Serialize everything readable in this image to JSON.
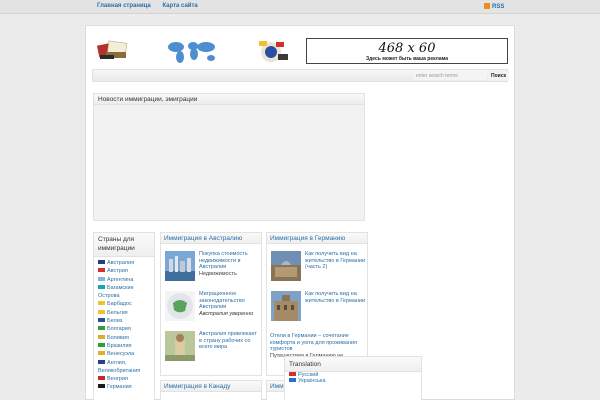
{
  "topnav": {
    "home": "Главная страница",
    "sitemap": "Карта сайта",
    "rss": "RSS"
  },
  "ad": {
    "size": "468 x 60",
    "caption": "Здесь может быть ваша реклама"
  },
  "search": {
    "placeholder": "enter search terms",
    "button": "Поиск"
  },
  "news": {
    "title": "Новости иммиграции, эмиграции"
  },
  "countries": {
    "title": "Страны для иммиграции",
    "items": [
      {
        "label": "Австралия",
        "flag_color": "#1f3d8a"
      },
      {
        "label": "Австрия",
        "flag_color": "#d32f2f"
      },
      {
        "label": "Аргентина",
        "flag_color": "#7fb6e6"
      },
      {
        "label": "Багамские Острова",
        "flag_color": "#1aa3b5"
      },
      {
        "label": "Барбадос",
        "flag_color": "#f2c12e"
      },
      {
        "label": "Бельгия",
        "flag_color": "#f2c12e"
      },
      {
        "label": "Белиз",
        "flag_color": "#2a4ea6"
      },
      {
        "label": "Болгария",
        "flag_color": "#3a9a3a"
      },
      {
        "label": "Боливия",
        "flag_color": "#d8b02a"
      },
      {
        "label": "Бразилия",
        "flag_color": "#2f9e3b"
      },
      {
        "label": "Венесуэла",
        "flag_color": "#e2b12a"
      },
      {
        "label": "Англия, Великобритания",
        "flag_color": "#2a3f8a"
      },
      {
        "label": "Венгрия",
        "flag_color": "#c62828"
      },
      {
        "label": "Германия",
        "flag_color": "#1b1b1b"
      }
    ]
  },
  "boxes": {
    "australia": {
      "title": "Иммиграция в Австралию",
      "entries": [
        {
          "title": "Покупка стоимость недвижимости в Австралии",
          "cat": "Недвижимость",
          "sub": ""
        },
        {
          "title": "Миграционное законодательство Австралии",
          "cat": "",
          "sub": "Австралия уверенно"
        },
        {
          "title": "Австралия привлекает в страну рабочих со всего мира",
          "cat": "",
          "sub": ""
        }
      ]
    },
    "germany": {
      "title": "Иммиграция в Германию",
      "entries": [
        {
          "title": "Как получить вид на жительство в Германии (часть 2)",
          "cat": "",
          "sub": ""
        },
        {
          "title": "Как получить вид на жительство в Германии",
          "cat": "",
          "sub": ""
        }
      ],
      "extra": {
        "title": "Отели в Германии – сочетание комфорта и уюта для проживания туристов",
        "cat": "Путешествия в Германию не"
      }
    },
    "canada": {
      "title": "Иммиграция в Канаду"
    },
    "usa": {
      "title": "Иммиграция в США, Америку"
    }
  },
  "translation": {
    "title": "Translation",
    "languages": [
      "Русский",
      "Українська"
    ]
  }
}
